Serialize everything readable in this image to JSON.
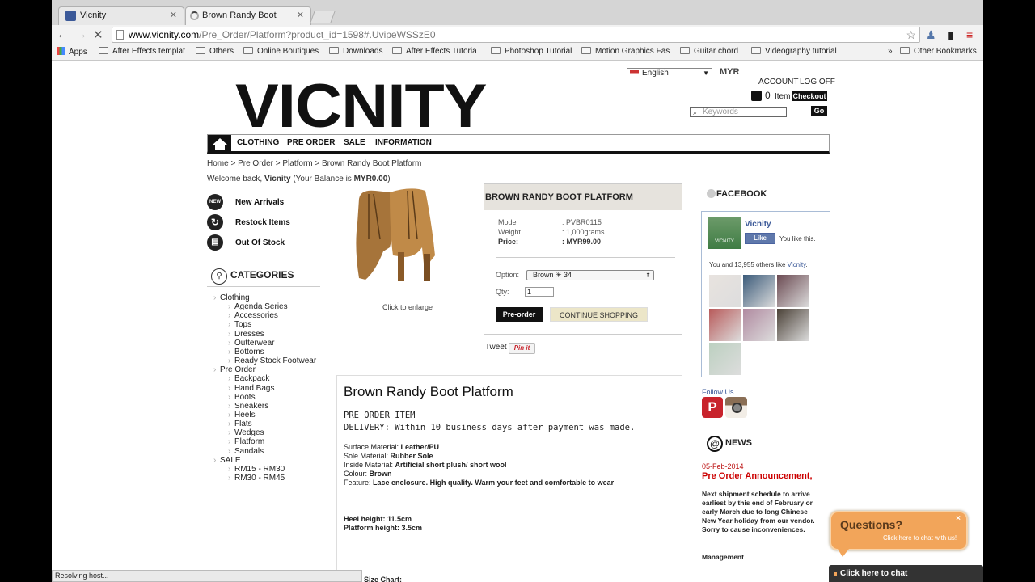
{
  "browser": {
    "tabs": [
      {
        "label": "Vicnity",
        "icon": "facebook-favicon"
      },
      {
        "label": "Brown Randy Boot Platform",
        "icon": "loading-favicon"
      }
    ],
    "url_host": "www.vicnity.com",
    "url_path": "/Pre_Order/Platform?product_id=1598#.UvipeWSSzE0",
    "bookmarks": [
      "Apps",
      "After Effects templat",
      "Others",
      "Online Boutiques",
      "Downloads",
      "After Effects Tutoria",
      "Photoshop Tutorial",
      "Motion Graphics Fas",
      "Guitar chord",
      "Videography tutorial",
      "»",
      "Other Bookmarks"
    ],
    "status": "Resolving host..."
  },
  "header": {
    "logo": "VICNITY",
    "language": "English",
    "currency": "MYR",
    "account": "ACCOUNT",
    "logoff": "LOG OFF",
    "cart_count": "0",
    "cart_label": "Item",
    "checkout": "Checkout",
    "search_placeholder": "Keywords",
    "go": "Go"
  },
  "menu": [
    "CLOTHING",
    "PRE ORDER",
    "SALE",
    "INFORMATION"
  ],
  "breadcrumb": "Home > Pre Order > Platform > Brown Randy Boot Platform",
  "welcome": {
    "prefix": "Welcome back, ",
    "name": "Vicnity",
    "mid": " (Your Balance is ",
    "balance": "MYR0.00",
    "suffix": ")"
  },
  "sidebar": {
    "links": [
      {
        "label": "New Arrivals",
        "badge": "NEW"
      },
      {
        "label": "Restock Items",
        "badge": ""
      },
      {
        "label": "Out Of Stock",
        "badge": ""
      }
    ],
    "categories_title": "CATEGORIES",
    "tree": [
      {
        "label": "Clothing",
        "level": 0
      },
      {
        "label": "Agenda Series",
        "level": 1
      },
      {
        "label": "Accessories",
        "level": 1
      },
      {
        "label": "Tops",
        "level": 1
      },
      {
        "label": "Dresses",
        "level": 1
      },
      {
        "label": "Outterwear",
        "level": 1
      },
      {
        "label": "Bottoms",
        "level": 1
      },
      {
        "label": "Ready Stock Footwear",
        "level": 1
      },
      {
        "label": "Pre Order",
        "level": 0
      },
      {
        "label": "Backpack",
        "level": 1
      },
      {
        "label": "Hand Bags",
        "level": 1
      },
      {
        "label": "Boots",
        "level": 1
      },
      {
        "label": "Sneakers",
        "level": 1
      },
      {
        "label": "Heels",
        "level": 1
      },
      {
        "label": "Flats",
        "level": 1
      },
      {
        "label": "Wedges",
        "level": 1
      },
      {
        "label": "Platform",
        "level": 1
      },
      {
        "label": "Sandals",
        "level": 1
      },
      {
        "label": "SALE",
        "level": 0
      },
      {
        "label": "RM15 - RM30",
        "level": 1
      },
      {
        "label": "RM30 - RM45",
        "level": 1
      }
    ]
  },
  "product": {
    "title": "BROWN RANDY BOOT PLATFORM",
    "enlarge": "Click to enlarge",
    "model_label": "Model",
    "model": ": PVBR0115",
    "weight_label": "Weight",
    "weight": ": 1,000grams",
    "price_label": "Price:",
    "price": ": MYR99.00",
    "option_label": "Option:",
    "option_value": "Brown ✳ 34",
    "qty_label": "Qty:",
    "qty": "1",
    "preorder_btn": "Pre-order",
    "continue_btn": "CONTINUE SHOPPING",
    "tweet": "Tweet",
    "pinit": "Pin it"
  },
  "description": {
    "title": "Brown Randy Boot Platform",
    "line1": "PRE ORDER ITEM",
    "line2": "DELIVERY: Within 10 business days after payment was made.",
    "surface_l": "Surface Material: ",
    "surface": "Leather/PU",
    "sole_l": "Sole Material: ",
    "sole": "Rubber Sole",
    "inside_l": "Inside Material: ",
    "inside": "Artificial short plush/ short wool",
    "colour_l": "Colour: ",
    "colour": "Brown",
    "feature_l": "Feature: ",
    "feature": "Lace enclosure. High quality. Warm your feet and comfortable to wear",
    "heel": "Heel height: 11.5cm",
    "platform": "Platform height: 3.5cm",
    "size_chart": "Size Chart:"
  },
  "facebook": {
    "title": "FACEBOOK",
    "page": "Vicnity",
    "logo_text": "VICNITY",
    "like": "Like",
    "you_like": "You like this.",
    "others_prefix": "You and 13,955 others like ",
    "others_page": "Vicnity",
    "others_suffix": ".",
    "photo_colors": [
      "#e8e3df",
      "#3b5b7a",
      "#6b4a52",
      "#b85a5a",
      "#b08aa0",
      "#4a4036",
      "#bcd0c0"
    ]
  },
  "follow": {
    "label": "Follow Us",
    "pinterest_glyph": "P"
  },
  "news": {
    "title": "NEWS",
    "date": "05-Feb-2014",
    "headline": "Pre Order Announcement,",
    "body": [
      "Next shipment schedule to arrive",
      "earliest by this end of February or",
      "early March due to long Chinese",
      "New Year holiday from our vendor.",
      "Sorry to cause inconveniences."
    ],
    "signoff": "Management"
  },
  "chat": {
    "title": "Questions?",
    "subtitle": "Click here to chat with us!",
    "close": "×",
    "bar": "Click here to chat"
  }
}
